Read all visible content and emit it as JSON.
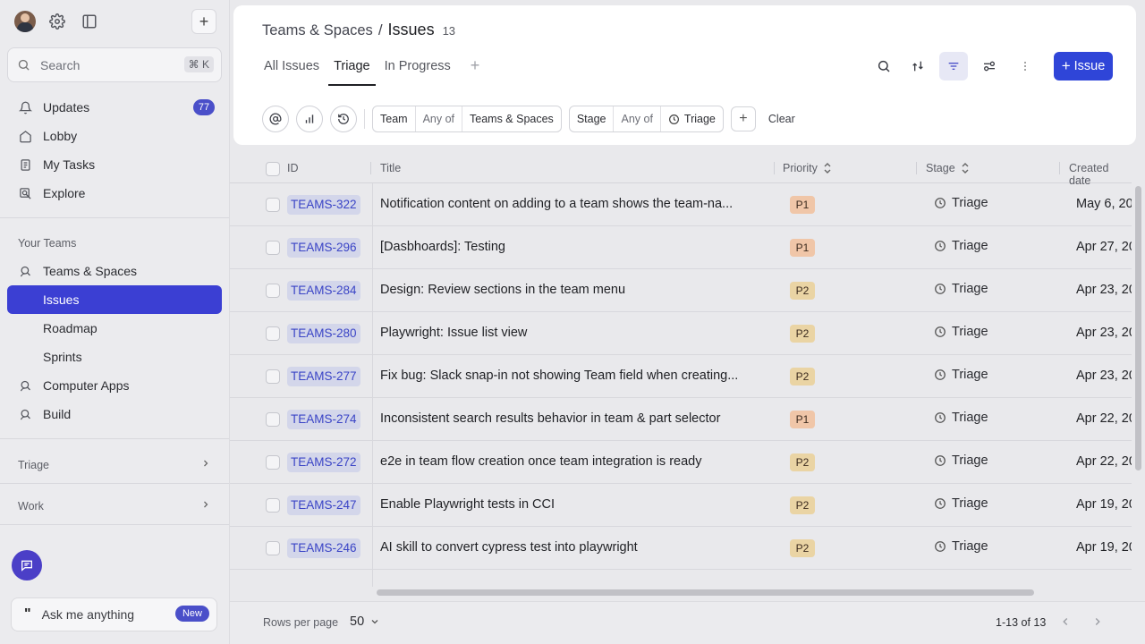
{
  "sidebar": {
    "search": {
      "placeholder": "Search",
      "shortcut": "⌘ K"
    },
    "nav": [
      {
        "label": "Updates",
        "icon": "bell-icon",
        "badge": "77"
      },
      {
        "label": "Lobby",
        "icon": "home-icon"
      },
      {
        "label": "My Tasks",
        "icon": "tasks-icon"
      },
      {
        "label": "Explore",
        "icon": "explore-icon"
      }
    ],
    "teams_heading": "Your Teams",
    "team": {
      "label": "Teams & Spaces",
      "icon": "team-icon"
    },
    "team_items": [
      "Issues",
      "Roadmap",
      "Sprints"
    ],
    "active_item": "Issues",
    "extra": [
      {
        "label": "Computer Apps",
        "icon": "team-icon"
      },
      {
        "label": "Build",
        "icon": "team-icon"
      }
    ],
    "sections": [
      "Triage",
      "Work"
    ],
    "ask": {
      "label": "Ask me anything",
      "badge": "New"
    }
  },
  "header": {
    "breadcrumb_parent": "Teams & Spaces",
    "breadcrumb_sep": "/",
    "title": "Issues",
    "count": "13",
    "tabs": [
      "All Issues",
      "Triage",
      "In Progress"
    ],
    "active_tab": "Triage",
    "tab_add": "+",
    "new_button": {
      "plus": "+",
      "label": "Issue"
    }
  },
  "filters": {
    "team": {
      "field": "Team",
      "op": "Any of",
      "value": "Teams & Spaces"
    },
    "stage": {
      "field": "Stage",
      "op": "Any of",
      "value": "Triage"
    },
    "add": "+",
    "clear": "Clear"
  },
  "table": {
    "columns": [
      "ID",
      "Title",
      "Priority",
      "Stage",
      "Created date"
    ],
    "rows": [
      {
        "id": "TEAMS-322",
        "title": "Notification content on adding to a team shows the team-na...",
        "priority": "P1",
        "stage": "Triage",
        "date": "May 6, 20"
      },
      {
        "id": "TEAMS-296",
        "title": "[Dasbhoards]: Testing",
        "priority": "P1",
        "stage": "Triage",
        "date": "Apr 27, 20"
      },
      {
        "id": "TEAMS-284",
        "title": "Design: Review sections in the team menu",
        "priority": "P2",
        "stage": "Triage",
        "date": "Apr 23, 20"
      },
      {
        "id": "TEAMS-280",
        "title": "Playwright: Issue list view",
        "priority": "P2",
        "stage": "Triage",
        "date": "Apr 23, 20"
      },
      {
        "id": "TEAMS-277",
        "title": "Fix bug: Slack snap-in not showing Team field when creating...",
        "priority": "P2",
        "stage": "Triage",
        "date": "Apr 23, 20"
      },
      {
        "id": "TEAMS-274",
        "title": "Inconsistent search results behavior in team & part selector",
        "priority": "P1",
        "stage": "Triage",
        "date": "Apr 22, 20"
      },
      {
        "id": "TEAMS-272",
        "title": "e2e in team flow creation once team integration is ready",
        "priority": "P2",
        "stage": "Triage",
        "date": "Apr 22, 20"
      },
      {
        "id": "TEAMS-247",
        "title": "Enable Playwright tests in CCI",
        "priority": "P2",
        "stage": "Triage",
        "date": "Apr 19, 20"
      },
      {
        "id": "TEAMS-246",
        "title": "AI skill to convert cypress test into playwright",
        "priority": "P2",
        "stage": "Triage",
        "date": "Apr 19, 20"
      }
    ]
  },
  "footer": {
    "rows_per_page_label": "Rows per page",
    "rows_per_page": "50",
    "range": "1-13 of 13"
  },
  "colors": {
    "accent": "#3b3fd3",
    "button": "#2f45d8",
    "p1": "#f0c6a8",
    "p2": "#ead4a4"
  }
}
